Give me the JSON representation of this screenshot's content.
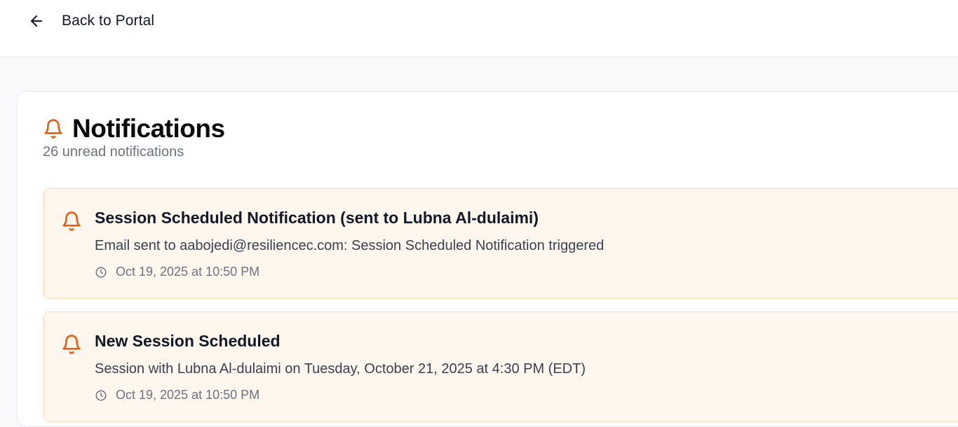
{
  "header": {
    "back_label": "Back to Portal",
    "back_icon": "arrow-left-icon"
  },
  "page": {
    "title": "Notifications",
    "title_icon": "bell-icon",
    "subtitle": "26 unread notifications"
  },
  "colors": {
    "accent": "#ea580c",
    "notification_bg": "#fff6ed",
    "notification_border": "#fcd9b6"
  },
  "notifications": [
    {
      "title": "Session Scheduled Notification (sent to Lubna Al-dulaimi)",
      "body": "Email sent to aabojedi@resiliencec.com: Session Scheduled Notification triggered",
      "time": "Oct 19, 2025 at 10:50 PM",
      "icon": "bell-icon"
    },
    {
      "title": "New Session Scheduled",
      "body": "Session with Lubna Al-dulaimi on Tuesday, October 21, 2025 at 4:30 PM (EDT)",
      "time": "Oct 19, 2025 at 10:50 PM",
      "icon": "bell-icon"
    }
  ]
}
